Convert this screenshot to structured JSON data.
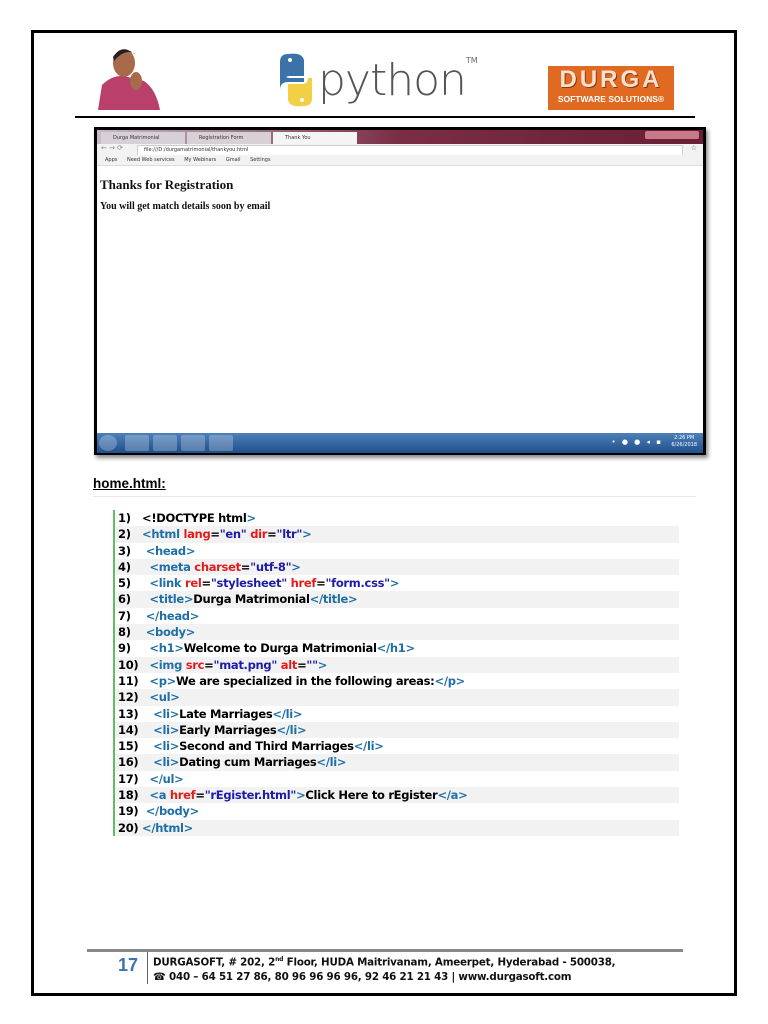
{
  "header": {
    "python_word": "python",
    "tm": "TM",
    "durga_big": "DURGA",
    "durga_small": "SOFTWARE SOLUTIONS®"
  },
  "browser": {
    "tabs": [
      "Durga Matrimonial",
      "Registration Form",
      "Thank You"
    ],
    "url": "file:///D:/durgamatrimonial/thankyou.html",
    "bookmarks": [
      "Apps",
      "Need Web services",
      "My Webinars",
      "Gmail",
      "Settings"
    ],
    "heading": "Thanks for Registration",
    "message": "You will get match details soon by email",
    "clock_time": "2:26 PM",
    "clock_date": "6/26/2018"
  },
  "file_label": "home.html:",
  "code_lines": [
    [
      [
        "text",
        "<!DOCTYPE html"
      ],
      [
        "tag",
        ">"
      ]
    ],
    [
      [
        "tag",
        "<html "
      ],
      [
        "attr",
        "lang"
      ],
      [
        "text",
        "="
      ],
      [
        "val",
        "\"en\" "
      ],
      [
        "attr",
        "dir"
      ],
      [
        "text",
        "="
      ],
      [
        "val",
        "\"ltr\""
      ],
      [
        "tag",
        ">"
      ]
    ],
    [
      [
        "tag",
        " <head>"
      ]
    ],
    [
      [
        "tag",
        "  <meta "
      ],
      [
        "attr",
        "charset"
      ],
      [
        "text",
        "="
      ],
      [
        "val",
        "\"utf-8\""
      ],
      [
        "tag",
        ">"
      ]
    ],
    [
      [
        "tag",
        "  <link "
      ],
      [
        "attr",
        "rel"
      ],
      [
        "text",
        "="
      ],
      [
        "val",
        "\"stylesheet\" "
      ],
      [
        "attr",
        "href"
      ],
      [
        "text",
        "="
      ],
      [
        "val",
        "\"form.css\""
      ],
      [
        "tag",
        ">"
      ]
    ],
    [
      [
        "tag",
        "  <title>"
      ],
      [
        "text",
        "Durga Matrimonial"
      ],
      [
        "tag",
        "</title>"
      ]
    ],
    [
      [
        "tag",
        " </head>"
      ]
    ],
    [
      [
        "tag",
        " <body>"
      ]
    ],
    [
      [
        "tag",
        "  <h1>"
      ],
      [
        "text",
        "Welcome to Durga Matrimonial"
      ],
      [
        "tag",
        "</h1>"
      ]
    ],
    [
      [
        "tag",
        "  <img "
      ],
      [
        "attr",
        "src"
      ],
      [
        "text",
        "="
      ],
      [
        "val",
        "\"mat.png\" "
      ],
      [
        "attr",
        "alt"
      ],
      [
        "text",
        "="
      ],
      [
        "val",
        "\"\""
      ],
      [
        "tag",
        ">"
      ]
    ],
    [
      [
        "tag",
        "  <p>"
      ],
      [
        "text",
        "We are specialized in the following areas:"
      ],
      [
        "tag",
        "</p>"
      ]
    ],
    [
      [
        "tag",
        "  <ul>"
      ]
    ],
    [
      [
        "tag",
        "   <li>"
      ],
      [
        "text",
        "Late Marriages"
      ],
      [
        "tag",
        "</li>"
      ]
    ],
    [
      [
        "tag",
        "   <li>"
      ],
      [
        "text",
        "Early Marriages"
      ],
      [
        "tag",
        "</li>"
      ]
    ],
    [
      [
        "tag",
        "   <li>"
      ],
      [
        "text",
        "Second and Third Marriages"
      ],
      [
        "tag",
        "</li>"
      ]
    ],
    [
      [
        "tag",
        "   <li>"
      ],
      [
        "text",
        "Dating cum Marriages"
      ],
      [
        "tag",
        "</li>"
      ]
    ],
    [
      [
        "tag",
        "  </ul>"
      ]
    ],
    [
      [
        "tag",
        "  <a "
      ],
      [
        "attr",
        "href"
      ],
      [
        "text",
        "="
      ],
      [
        "val",
        "\"rEgister.html\""
      ],
      [
        "tag",
        ">"
      ],
      [
        "text",
        "Click Here to rEgister"
      ],
      [
        "tag",
        "</a>"
      ]
    ],
    [
      [
        "tag",
        " </body>"
      ]
    ],
    [
      [
        "tag",
        "</html>"
      ]
    ]
  ],
  "footer": {
    "page_number": "17",
    "address_pre": "DURGASOFT, # 202, 2",
    "address_sup": "nd",
    "address_post": " Floor, HUDA Maitrivanam, Ameerpet, Hyderabad - 500038,",
    "phone_icon": "☎",
    "contact": " 040 – 64 51 27 86, 80 96 96 96 96, 92 46 21 21 43 | www.durgasoft.com"
  }
}
